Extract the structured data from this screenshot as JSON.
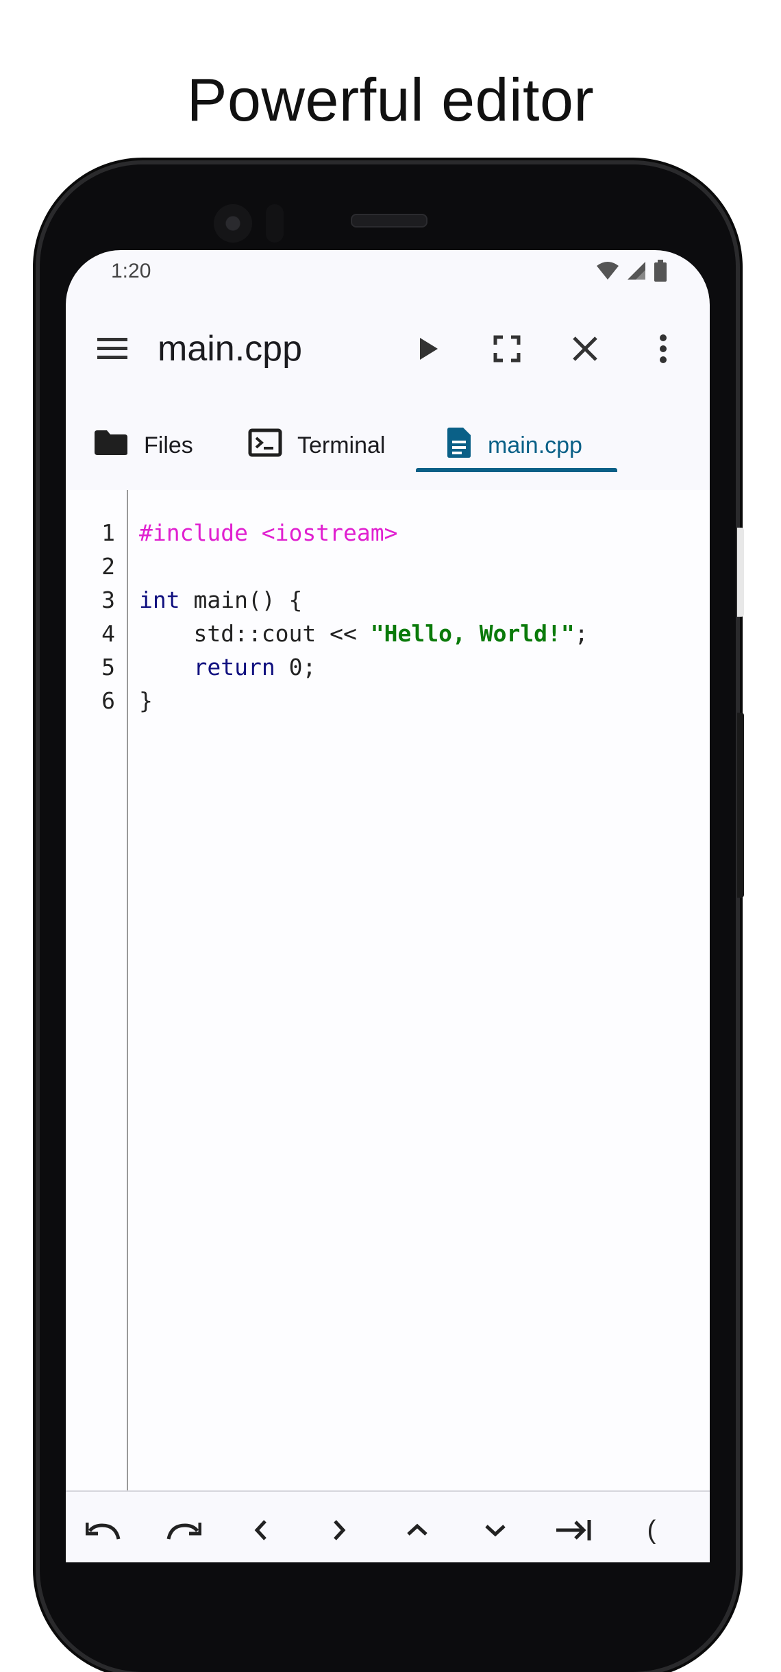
{
  "headline": "Powerful editor",
  "status": {
    "time": "1:20",
    "icons": [
      "wifi-icon",
      "cell-signal-icon",
      "battery-icon"
    ]
  },
  "appbar": {
    "title": "main.cpp",
    "actions": [
      "run-icon",
      "fullscreen-icon",
      "close-icon",
      "more-vert-icon"
    ]
  },
  "tabs": [
    {
      "label": "Files",
      "icon": "folder-icon",
      "active": false
    },
    {
      "label": "Terminal",
      "icon": "terminal-icon",
      "active": false
    },
    {
      "label": "main.cpp",
      "icon": "document-icon",
      "active": true
    }
  ],
  "colors": {
    "accent": "#0a6087",
    "preprocessor": "#e020d0",
    "keyword": "#10107f",
    "string": "#0a7a0a"
  },
  "editor": {
    "line_numbers": [
      "1",
      "2",
      "3",
      "4",
      "5",
      "6"
    ],
    "lines": {
      "l1": {
        "pre": "#include <iostream>"
      },
      "l3": {
        "kw": "int",
        "rest": " main() {"
      },
      "l4": {
        "indent": "    std::cout << ",
        "str": "\"Hello, World!\"",
        "end": ";"
      },
      "l5": {
        "indent": "    ",
        "kw": "return",
        "rest": " 0;"
      },
      "l6": {
        "text": "}"
      }
    }
  },
  "bottom_keys": [
    "undo-icon",
    "redo-icon",
    "arrow-left-icon",
    "arrow-right-icon",
    "arrow-up-icon",
    "arrow-down-icon",
    "tab-key-icon",
    "("
  ],
  "bottom_paren": "("
}
